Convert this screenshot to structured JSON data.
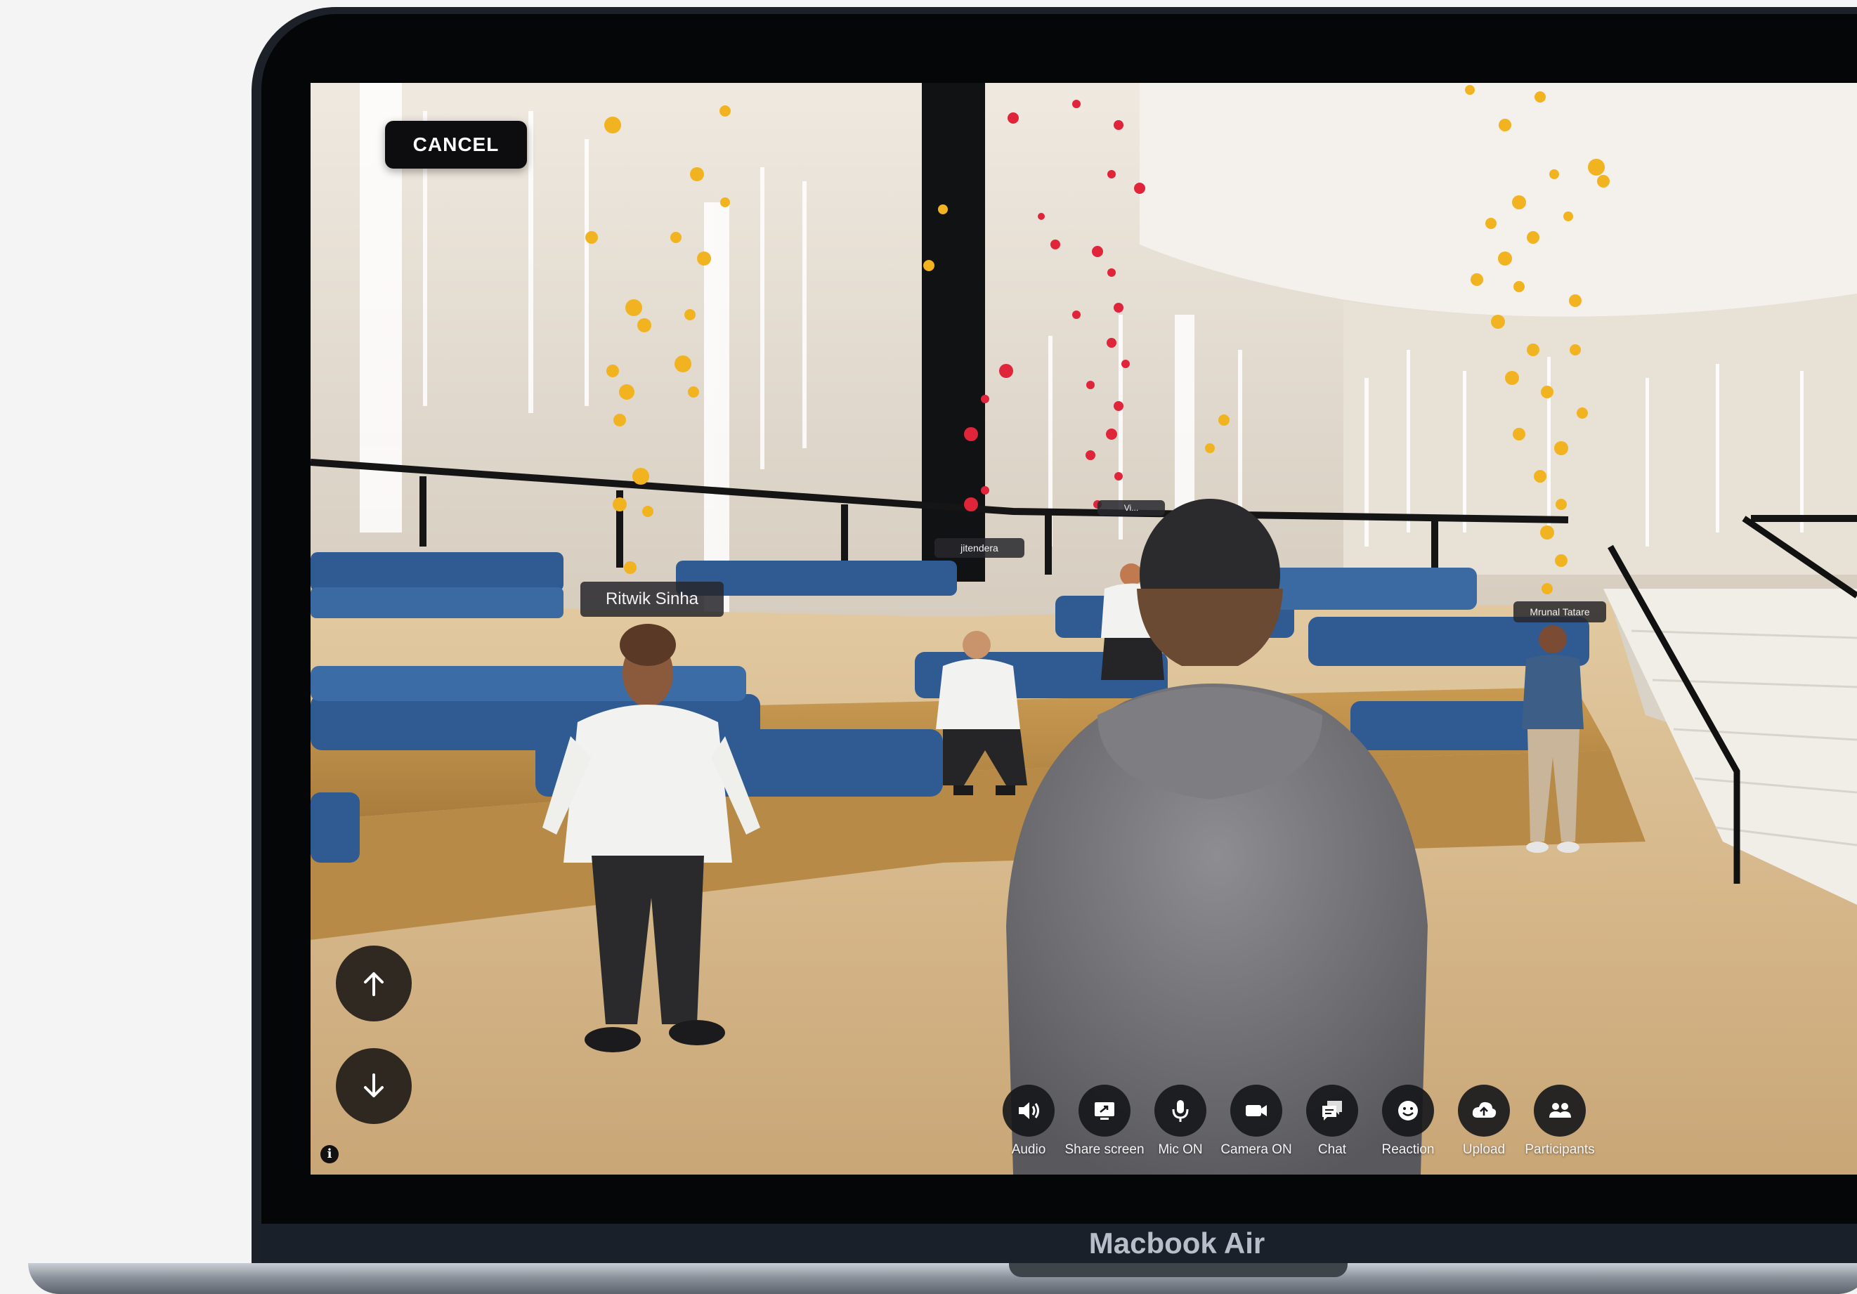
{
  "device": {
    "label": "Macbook Air"
  },
  "overlay": {
    "cancel_label": "CANCEL"
  },
  "participants": {
    "tag_1": "Ritwik Sinha",
    "tag_2": "jitendera",
    "tag_3": "Vi...",
    "tag_4": "Mrunal Tatare"
  },
  "navigation": {
    "up_icon": "arrow-up-icon",
    "down_icon": "arrow-down-icon",
    "info_icon": "info-icon"
  },
  "toolbar": {
    "items": [
      {
        "label": "Audio",
        "icon": "speaker-icon"
      },
      {
        "label": "Share screen",
        "icon": "share-screen-icon"
      },
      {
        "label": "Mic ON",
        "icon": "microphone-icon"
      },
      {
        "label": "Camera ON",
        "icon": "camera-icon"
      },
      {
        "label": "Chat",
        "icon": "chat-icon"
      },
      {
        "label": "Reaction",
        "icon": "smiley-icon"
      },
      {
        "label": "Upload",
        "icon": "cloud-upload-icon"
      },
      {
        "label": "Participants",
        "icon": "participants-icon"
      }
    ]
  },
  "colors": {
    "bezel": "#050607",
    "lid": "#1b2029",
    "seat_blue": "#2f5b92",
    "heart_red": "#e0243a",
    "reaction_yellow": "#f2b320",
    "floor": "#d8bd8f"
  }
}
